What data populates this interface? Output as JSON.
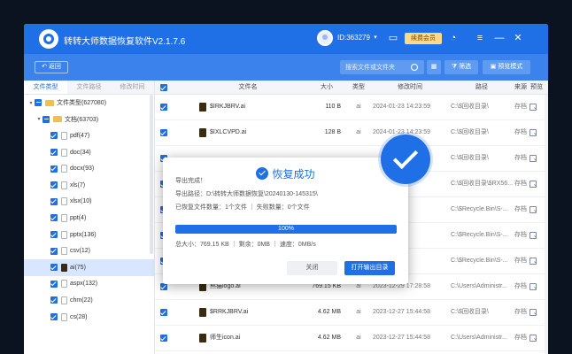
{
  "app": {
    "title": "转转大师数据恢复软件V2.1.7.6",
    "user_id": "ID:363279",
    "vip_label": "续费会员"
  },
  "toolbar": {
    "back_label": "返回",
    "search_placeholder": "搜索文件或文件夹",
    "filter_label": "筛选",
    "preview_mode_label": "预览模式"
  },
  "sidebar": {
    "tabs": [
      {
        "label": "文件类型",
        "active": true
      },
      {
        "label": "文件路径",
        "active": false
      },
      {
        "label": "修改时间",
        "active": false
      }
    ],
    "tree": [
      {
        "label": "文件类型(627080)",
        "level": 0,
        "check": "partial",
        "folder": true
      },
      {
        "label": "文档(63703)",
        "level": 1,
        "check": "partial",
        "folder": true
      },
      {
        "label": "pdf(47)",
        "level": 2,
        "check": "checked"
      },
      {
        "label": "doc(34)",
        "level": 2,
        "check": "checked"
      },
      {
        "label": "docx(93)",
        "level": 2,
        "check": "checked"
      },
      {
        "label": "xls(7)",
        "level": 2,
        "check": "checked"
      },
      {
        "label": "xlsx(10)",
        "level": 2,
        "check": "checked"
      },
      {
        "label": "ppt(4)",
        "level": 2,
        "check": "checked"
      },
      {
        "label": "pptx(136)",
        "level": 2,
        "check": "checked"
      },
      {
        "label": "csv(12)",
        "level": 2,
        "check": "checked"
      },
      {
        "label": "ai(75)",
        "level": 2,
        "check": "checked",
        "selected": true
      },
      {
        "label": "aspx(132)",
        "level": 2,
        "check": "checked"
      },
      {
        "label": "chm(22)",
        "level": 2,
        "check": "checked"
      },
      {
        "label": "cs(28)",
        "level": 2,
        "check": "checked"
      }
    ]
  },
  "table": {
    "headers": [
      "文件名",
      "大小",
      "类型",
      "修改时间",
      "路径",
      "来源",
      "预览"
    ],
    "rows": [
      {
        "name": "$IRKJBRV.ai",
        "size": "110 B",
        "type": "ai",
        "time": "2024-01-23 14:23:59",
        "path": "C:\\$回收目录\\",
        "source": "存档"
      },
      {
        "name": "$IXLCVPD.ai",
        "size": "128 B",
        "type": "ai",
        "time": "2024-01-23 14:23:59",
        "path": "C:\\$回收目录\\",
        "source": "存档"
      },
      {
        "name": "",
        "size": "",
        "type": "",
        "time": "",
        "path": "C:\\$回收目录\\",
        "source": "存档"
      },
      {
        "name": "",
        "size": "",
        "type": "",
        "time": "",
        "path": "C:\\$回收目录\\$RX56...",
        "source": "存档"
      },
      {
        "name": "",
        "size": "",
        "type": "",
        "time": "",
        "path": "C:\\$Recycle.Bin\\S-...",
        "source": "存档"
      },
      {
        "name": "",
        "size": "",
        "type": "",
        "time": "",
        "path": "C:\\$Recycle.Bin\\S-...",
        "source": "存档"
      },
      {
        "name": "",
        "size": "",
        "type": "",
        "time": "",
        "path": "C:\\$Recycle.Bin\\S-...",
        "source": "存档"
      },
      {
        "name": "熊猫logo.ai",
        "size": "769.15 KB",
        "type": "ai",
        "time": "2023-12-29 17:28:58",
        "path": "C:\\Users\\Administr...",
        "source": "存档"
      },
      {
        "name": "$RRKJBRV.ai",
        "size": "4.62 MB",
        "type": "ai",
        "time": "2023-12-27 15:44:58",
        "path": "C:\\$回收目录\\",
        "source": "存档"
      },
      {
        "name": "师生icon.ai",
        "size": "4.62 MB",
        "type": "ai",
        "time": "2023-12-27 15:44:58",
        "path": "C:\\Users\\Administr...",
        "source": "存档"
      }
    ]
  },
  "dialog": {
    "title": "恢复成功",
    "line1": "导出完成！",
    "line2": "导出路径：D:\\转转大师数据恢复\\20240130-145315\\",
    "line3": "已恢复文件数量：1个文件 ｜ 失败数量：0个文件",
    "progress_text": "100%",
    "progress": 1.0,
    "stats": "总大小：769.15 KB ｜ 剩余：0MB ｜ 速度：0MB/s",
    "close_label": "关闭",
    "open_label": "打开输出目录"
  },
  "colors": {
    "accent": "#1f6fe6",
    "toolbar": "#3b82ec",
    "vip": "#ffd98a"
  }
}
